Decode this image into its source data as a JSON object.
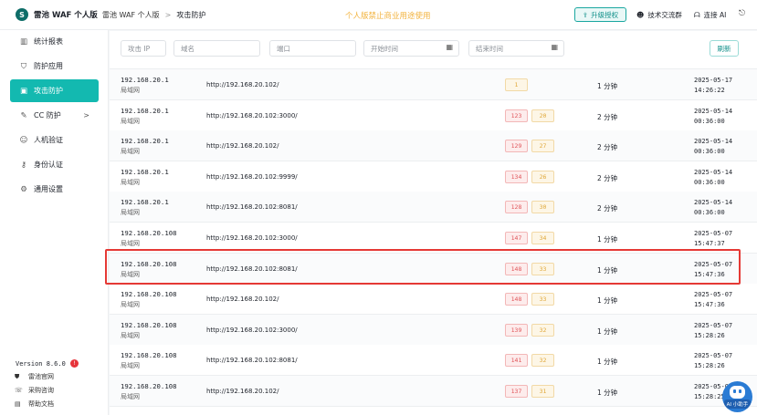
{
  "app": {
    "logo_glyph": "S",
    "title": "雷池 WAF 个人版",
    "notice": "个人版禁止商业用途使用",
    "upgrade_label": "升级授权",
    "tech_group_label": "技术交流群",
    "ai_link_label": "连接 AI",
    "ai_assistant_label": "AI 小助手"
  },
  "breadcrumb": {
    "root": "雷池 WAF 个人版",
    "separator": ">",
    "current": "攻击防护"
  },
  "sidebar": {
    "items": [
      {
        "label": "统计报表",
        "icon": "bar-chart-icon"
      },
      {
        "label": "防护应用",
        "icon": "shield-icon"
      },
      {
        "label": "攻击防护",
        "icon": "attack-icon"
      },
      {
        "label": "CC 防护",
        "icon": "wrench-icon",
        "chevron": ">"
      },
      {
        "label": "人机验证",
        "icon": "human-icon"
      },
      {
        "label": "身份认证",
        "icon": "key-icon"
      },
      {
        "label": "通用设置",
        "icon": "gear-icon"
      }
    ],
    "active_index": 2,
    "version": "Version 8.6.0",
    "version_badge": "!",
    "footer_links": [
      {
        "label": "雷池官网",
        "icon": "shield-small-icon"
      },
      {
        "label": "采购咨询",
        "icon": "headset-icon"
      },
      {
        "label": "帮助文档",
        "icon": "doc-icon"
      }
    ]
  },
  "filters": {
    "attack_ip_placeholder": "攻击 IP",
    "domain_placeholder": "域名",
    "port_placeholder": "端口",
    "start_time_placeholder": "开始时间",
    "end_time_placeholder": "结束时间",
    "refresh_label": "刷新"
  },
  "rows": [
    {
      "ip": "192.168.20.1",
      "net": "局域网",
      "url": "http://192.168.20.102/",
      "red": "1",
      "yel": "",
      "dur": "1 分钟",
      "date": "2025-05-17",
      "time": "14:26:22"
    },
    {
      "ip": "192.168.20.1",
      "net": "局域网",
      "url": "http://192.168.20.102:3000/",
      "red": "123",
      "yel": "20",
      "dur": "2 分钟",
      "date": "2025-05-14",
      "time": "00:36:00"
    },
    {
      "ip": "192.168.20.1",
      "net": "局域网",
      "url": "http://192.168.20.102/",
      "red": "129",
      "yel": "27",
      "dur": "2 分钟",
      "date": "2025-05-14",
      "time": "00:36:00"
    },
    {
      "ip": "192.168.20.1",
      "net": "局域网",
      "url": "http://192.168.20.102:9999/",
      "red": "134",
      "yel": "26",
      "dur": "2 分钟",
      "date": "2025-05-14",
      "time": "00:36:00"
    },
    {
      "ip": "192.168.20.1",
      "net": "局域网",
      "url": "http://192.168.20.102:8081/",
      "red": "128",
      "yel": "30",
      "dur": "2 分钟",
      "date": "2025-05-14",
      "time": "00:36:00"
    },
    {
      "ip": "192.168.20.108",
      "net": "局域网",
      "url": "http://192.168.20.102:3000/",
      "red": "147",
      "yel": "34",
      "dur": "1 分钟",
      "date": "2025-05-07",
      "time": "15:47:37"
    },
    {
      "ip": "192.168.20.108",
      "net": "局域网",
      "url": "http://192.168.20.102:8081/",
      "red": "148",
      "yel": "33",
      "dur": "1 分钟",
      "date": "2025-05-07",
      "time": "15:47:36"
    },
    {
      "ip": "192.168.20.108",
      "net": "局域网",
      "url": "http://192.168.20.102/",
      "red": "148",
      "yel": "33",
      "dur": "1 分钟",
      "date": "2025-05-07",
      "time": "15:47:36"
    },
    {
      "ip": "192.168.20.108",
      "net": "局域网",
      "url": "http://192.168.20.102:3000/",
      "red": "139",
      "yel": "32",
      "dur": "1 分钟",
      "date": "2025-05-07",
      "time": "15:28:26"
    },
    {
      "ip": "192.168.20.108",
      "net": "局域网",
      "url": "http://192.168.20.102:8081/",
      "red": "141",
      "yel": "32",
      "dur": "1 分钟",
      "date": "2025-05-07",
      "time": "15:28:26"
    },
    {
      "ip": "192.168.20.108",
      "net": "局域网",
      "url": "http://192.168.20.102/",
      "red": "137",
      "yel": "31",
      "dur": "1 分钟",
      "date": "2025-05-07",
      "time": "15:28:25"
    }
  ],
  "highlighted_row_index": 6,
  "colors": {
    "accent": "#13b9b0",
    "highlight_border": "#e53935",
    "notice": "#f2b23c"
  }
}
